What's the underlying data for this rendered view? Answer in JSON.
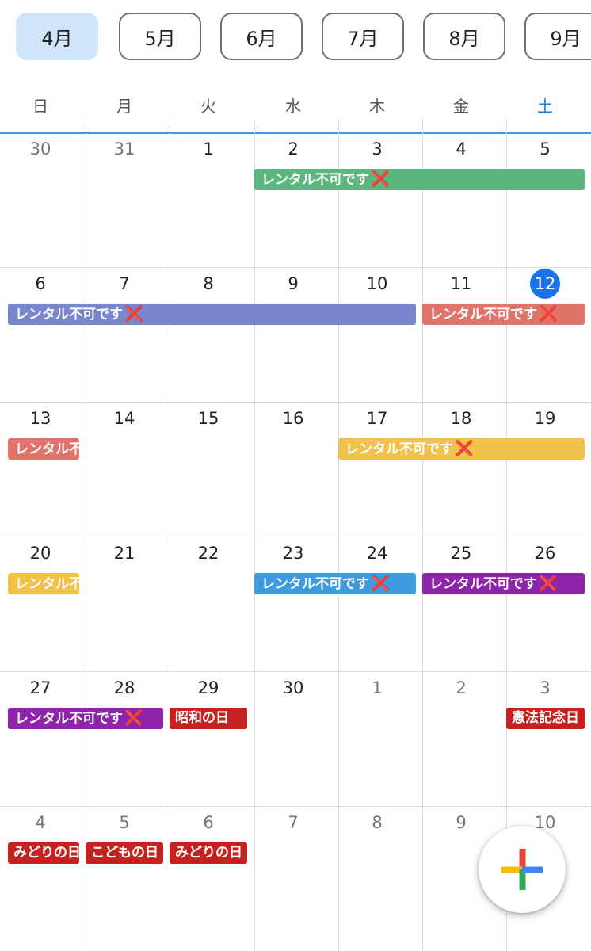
{
  "month_tabs": [
    "4月",
    "5月",
    "6月",
    "7月",
    "8月",
    "9月"
  ],
  "weekdays": [
    "日",
    "月",
    "火",
    "水",
    "木",
    "金",
    "土"
  ],
  "weeks": [
    [
      "30",
      "31",
      "1",
      "2",
      "3",
      "4",
      "5"
    ],
    [
      "6",
      "7",
      "8",
      "9",
      "10",
      "11",
      "12"
    ],
    [
      "13",
      "14",
      "15",
      "16",
      "17",
      "18",
      "19"
    ],
    [
      "20",
      "21",
      "22",
      "23",
      "24",
      "25",
      "26"
    ],
    [
      "27",
      "28",
      "29",
      "30",
      "1",
      "2",
      "3"
    ],
    [
      "4",
      "5",
      "6",
      "7",
      "8",
      "9",
      "10"
    ]
  ],
  "events": [
    {
      "title": "レンタル不可です",
      "mark": "❌",
      "color": "#5bb77d"
    },
    {
      "title": "レンタル不可です",
      "mark": "❌",
      "color": "#7986cb"
    },
    {
      "title": "レンタル不可です",
      "mark": "❌",
      "color": "#e0746b"
    },
    {
      "title": "レンタル不可です",
      "mark": "❌",
      "color": "#e0746b"
    },
    {
      "title": "レンタル不可です",
      "mark": "❌",
      "color": "#f0c14b"
    },
    {
      "title": "レンタル不可です",
      "mark": "❌",
      "color": "#f0c14b"
    },
    {
      "title": "レンタル不可です",
      "mark": "❌",
      "color": "#3d9be0"
    },
    {
      "title": "レンタル不可です",
      "mark": "❌",
      "color": "#8e24aa"
    },
    {
      "title": "レンタル不可です",
      "mark": "❌",
      "color": "#8e24aa"
    },
    {
      "title": "昭和の日",
      "mark": "",
      "color": "#c5221f"
    },
    {
      "title": "憲法記念日",
      "mark": "",
      "color": "#c5221f"
    },
    {
      "title": "みどりの日",
      "mark": "",
      "color": "#c5221f"
    },
    {
      "title": "こどもの日",
      "mark": "",
      "color": "#c5221f"
    },
    {
      "title": "みどりの日",
      "mark": "",
      "color": "#c5221f"
    }
  ],
  "colors": {
    "accent": "#1a73e8",
    "selected_tab": "#cfe6fa",
    "holiday": "#c5221f"
  },
  "fab_icon": "plus-icon"
}
